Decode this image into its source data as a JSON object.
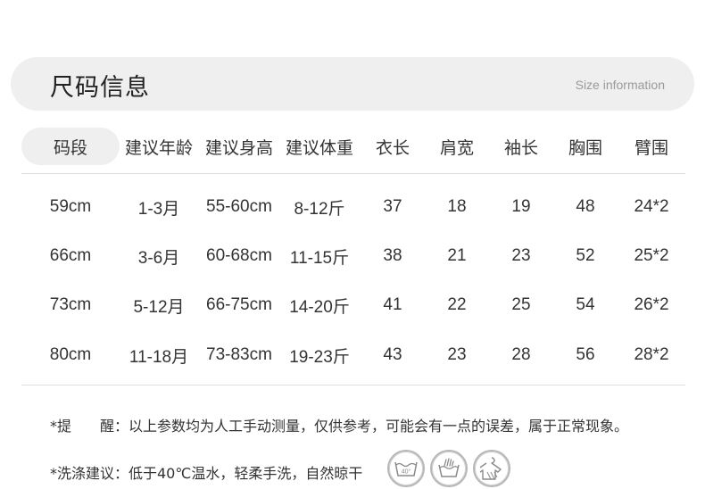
{
  "header": {
    "title": "尺码信息",
    "subtitle": "Size information"
  },
  "table": {
    "columns": [
      "码段",
      "建议年龄",
      "建议身高",
      "建议体重",
      "衣长",
      "肩宽",
      "袖长",
      "胸围",
      "臂围"
    ],
    "rows": [
      [
        "59cm",
        "1-3月",
        "55-60cm",
        "8-12斤",
        "37",
        "18",
        "19",
        "48",
        "24*2"
      ],
      [
        "66cm",
        "3-6月",
        "60-68cm",
        "11-15斤",
        "38",
        "21",
        "23",
        "52",
        "25*2"
      ],
      [
        "73cm",
        "5-12月",
        "66-75cm",
        "14-20斤",
        "41",
        "22",
        "25",
        "54",
        "26*2"
      ],
      [
        "80cm",
        "11-18月",
        "73-83cm",
        "19-23斤",
        "43",
        "23",
        "28",
        "56",
        "28*2"
      ]
    ]
  },
  "notes": {
    "reminder": "*提　　醒：以上参数均为人工手动测量，仅供参考，可能会有一点的误差，属于正常现象。",
    "washing": "*洗涤建议：低于40℃温水，轻柔手洗，自然晾干"
  },
  "care_icons": [
    {
      "icon": "wash-40-icon",
      "label": "40°"
    },
    {
      "icon": "hand-wash-icon"
    },
    {
      "icon": "line-dry-icon"
    }
  ],
  "colors": {
    "pill_bg": "#efefef",
    "text": "#333333",
    "divider": "#dedede"
  }
}
